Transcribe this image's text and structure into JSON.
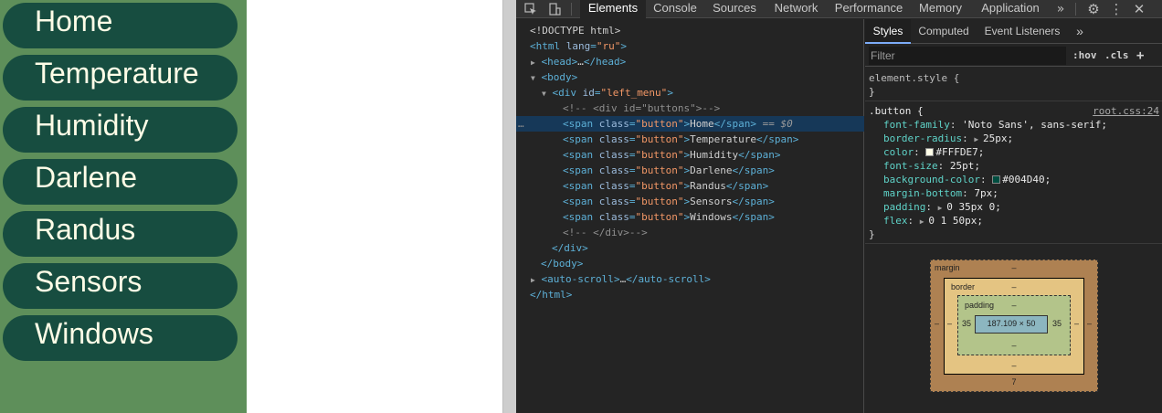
{
  "menu": {
    "items": [
      "Home",
      "Temperature",
      "Humidity",
      "Darlene",
      "Randus",
      "Sensors",
      "Windows"
    ]
  },
  "devtools": {
    "icons": [
      "inspect-element-icon",
      "device-toolbar-icon",
      "more-tabs-icon",
      "settings-gear-icon",
      "kebab-menu-icon",
      "close-icon"
    ],
    "tabs": [
      "Elements",
      "Console",
      "Sources",
      "Network",
      "Performance",
      "Memory",
      "Application"
    ],
    "more_tabs": "»",
    "active_tab": "Elements",
    "tree": {
      "doctype": "<!DOCTYPE html>",
      "html_open_tag": "html",
      "html_attr_name": "lang",
      "html_attr_val": "\"ru\"",
      "head_tag": "head",
      "ellipsis": "…",
      "body_tag": "body",
      "div_tag": "div",
      "div_attr_name": "id",
      "div_attr_val": "\"left_menu\"",
      "comment_open": "<!--    <div id=\"buttons\">-->",
      "span_tag": "span",
      "span_attr_name": "class",
      "span_attr_val": "\"button\"",
      "selected_suffix": "== $0",
      "dots": "…",
      "comment_close": "<!--    </div>-->",
      "div_close": "</div>",
      "body_close": "</body>",
      "autoscroll_tag": "auto-scroll",
      "html_close": "</html>"
    },
    "styles": {
      "tabs": [
        "Styles",
        "Computed",
        "Event Listeners"
      ],
      "more_tabs": "»",
      "filter_placeholder": "Filter",
      "hov": ":hov",
      "cls": ".cls",
      "add": "+",
      "element_style": "element.style {",
      "close_brace": "}",
      "rule_selector": ".button {",
      "rule_source": "root.css:24",
      "properties": [
        {
          "name": "font-family",
          "value": "'Noto Sans', sans-serif;"
        },
        {
          "name": "border-radius",
          "value": "25px;",
          "expander": "▶ "
        },
        {
          "name": "color",
          "value": "#FFFDE7;",
          "swatch": "#FFFDE7"
        },
        {
          "name": "font-size",
          "value": "25pt;"
        },
        {
          "name": "background-color",
          "value": "#004D40;",
          "swatch": "#004D40"
        },
        {
          "name": "margin-bottom",
          "value": "7px;"
        },
        {
          "name": "padding",
          "value": "0 35px 0;",
          "expander": "▶ "
        },
        {
          "name": "flex",
          "value": "0 1 50px;",
          "expander": "▶ "
        }
      ]
    },
    "box_model": {
      "margin_label": "margin",
      "border_label": "border",
      "padding_label": "padding",
      "content_size": "187.109 × 50",
      "dash": "–",
      "padding_left": "35",
      "padding_right": "35",
      "margin_bottom": "7"
    }
  }
}
